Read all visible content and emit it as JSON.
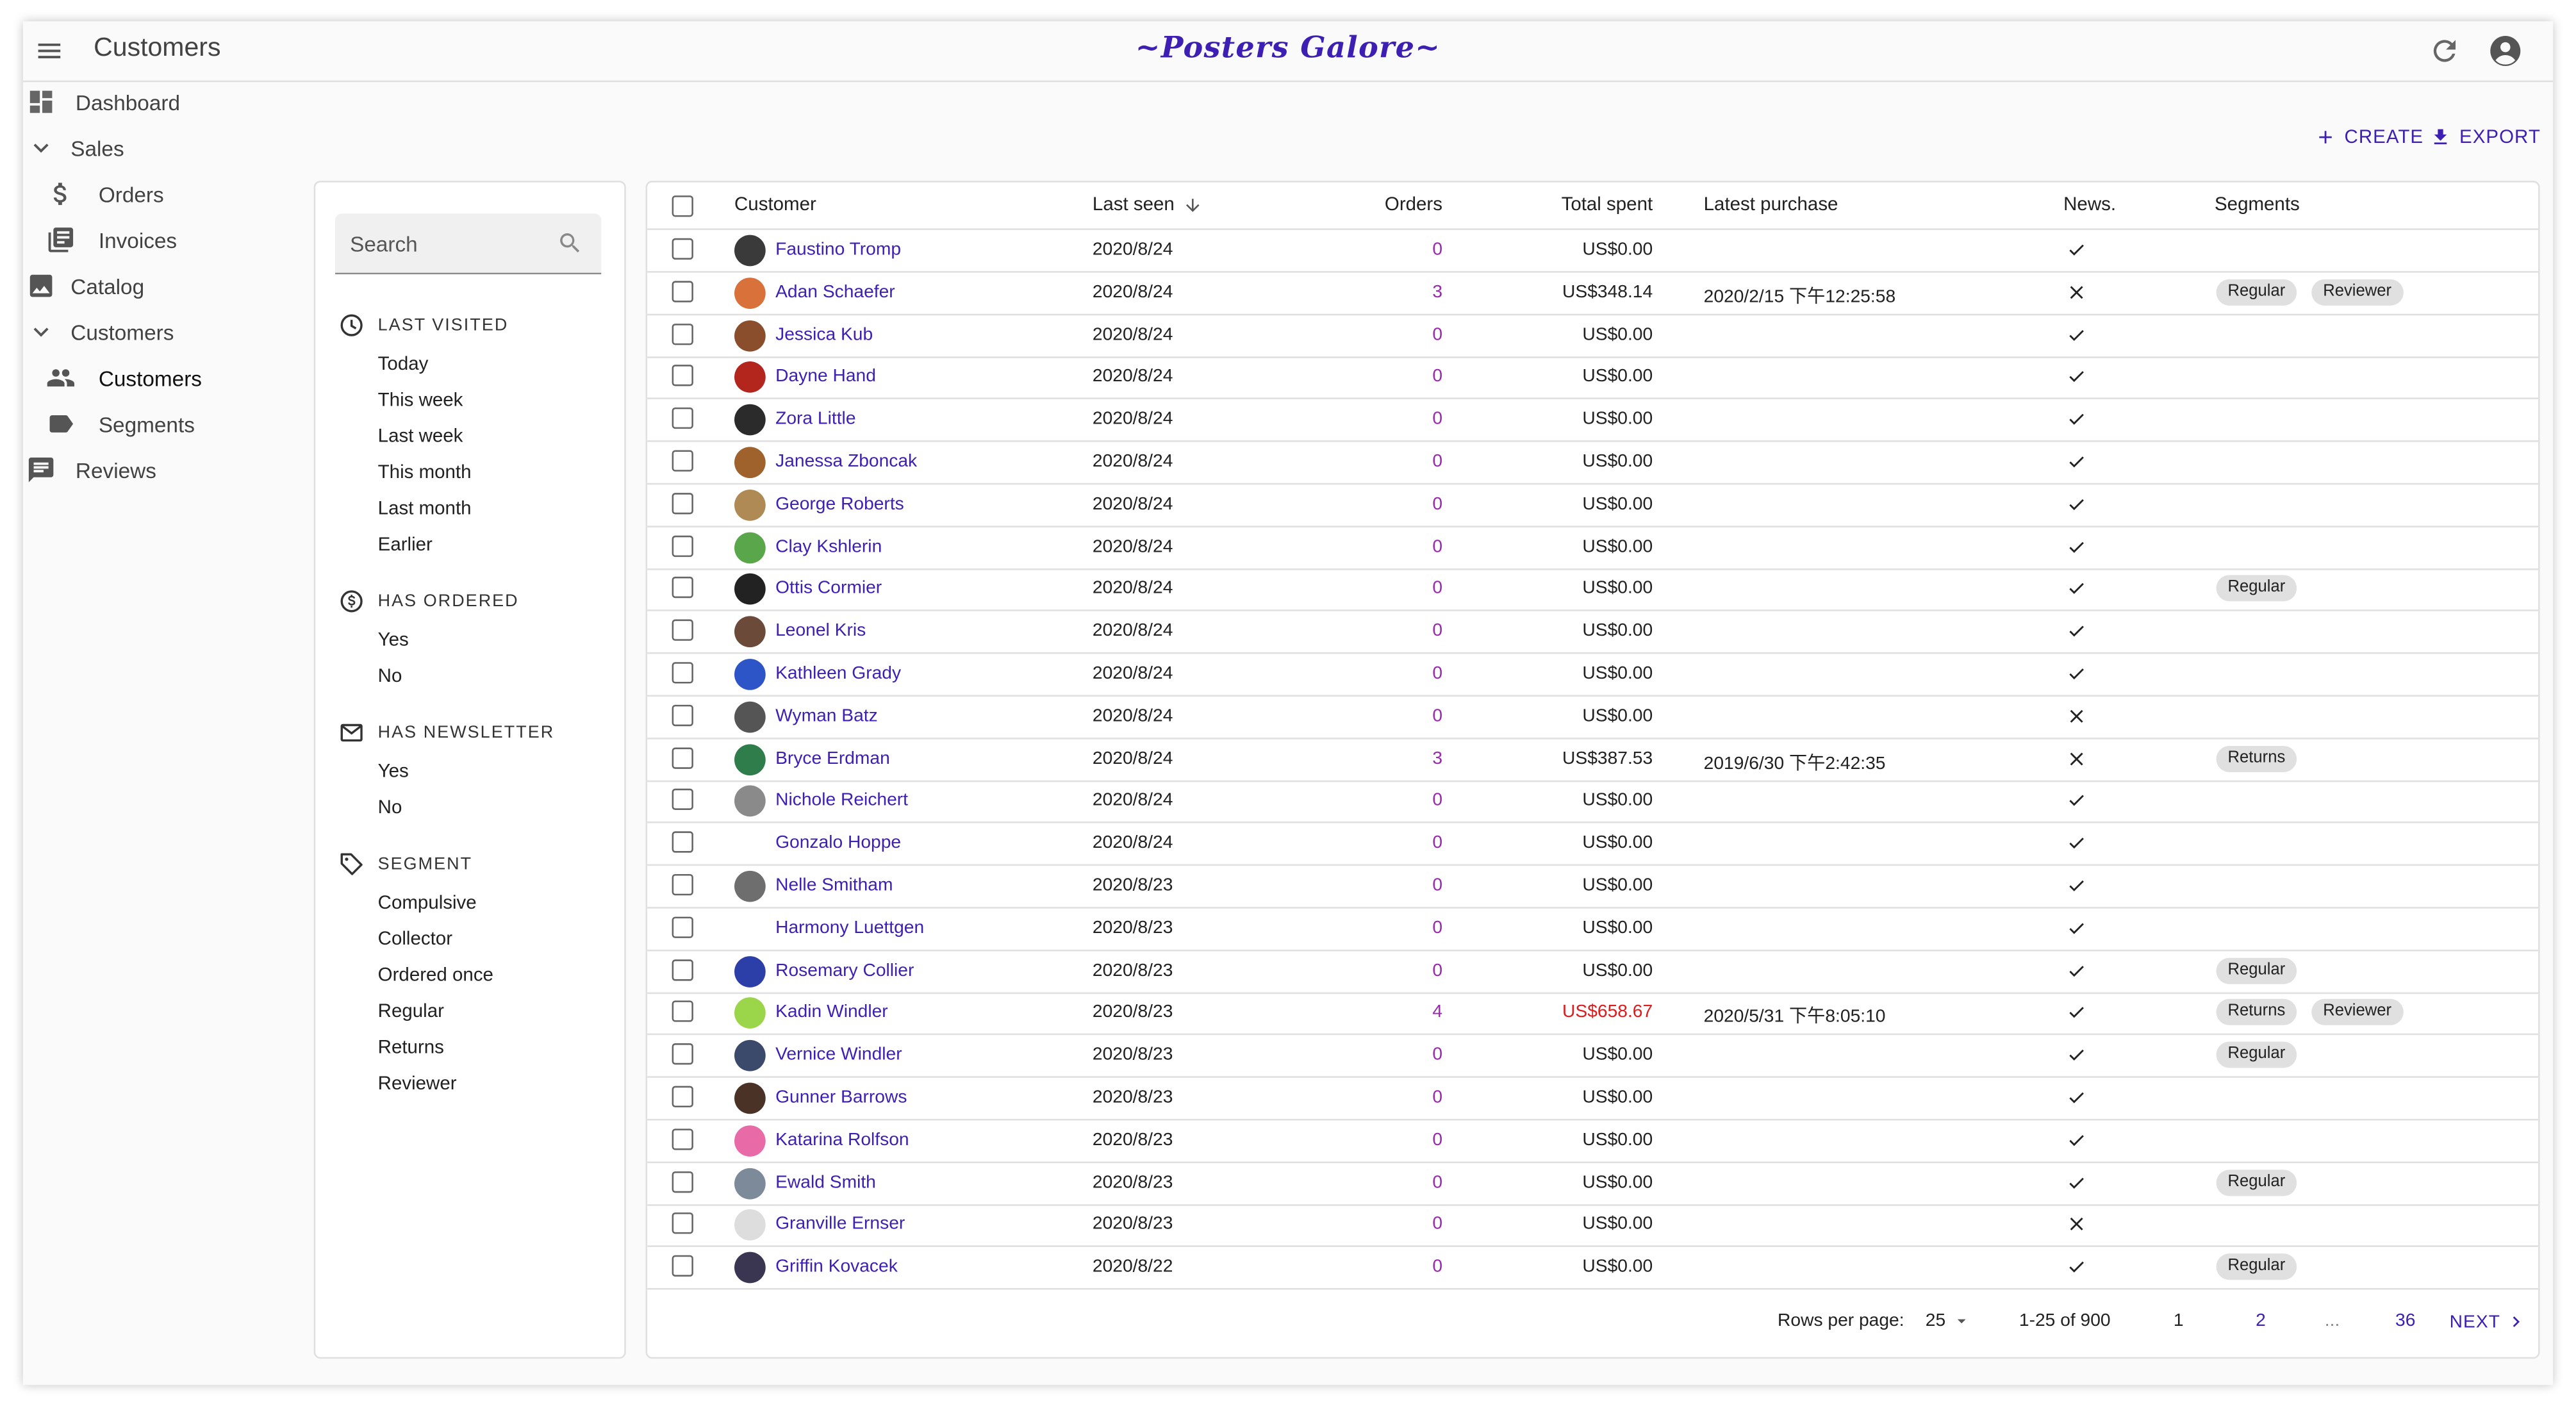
{
  "app": {
    "title": "Customers",
    "brand": "~Posters Galore~"
  },
  "sidebar": {
    "items": [
      {
        "label": "Dashboard",
        "icon": "dashboard-icon",
        "x": 0,
        "y": 0,
        "indent": 0
      },
      {
        "label": "Sales",
        "icon": "chevron-down-icon",
        "indent": 0
      },
      {
        "label": "Orders",
        "icon": "dollar-icon",
        "indent": 1
      },
      {
        "label": "Invoices",
        "icon": "invoice-icon",
        "indent": 1
      },
      {
        "label": "Catalog",
        "icon": "image-icon",
        "indent": 0
      },
      {
        "label": "Customers",
        "icon": "chevron-down-icon",
        "indent": 0
      },
      {
        "label": "Customers",
        "icon": "people-icon",
        "indent": 1,
        "active": true
      },
      {
        "label": "Segments",
        "icon": "label-icon",
        "indent": 1
      },
      {
        "label": "Reviews",
        "icon": "comment-icon",
        "indent": 0
      }
    ]
  },
  "actions": {
    "create": "CREATE",
    "export": "EXPORT"
  },
  "filters": {
    "search_placeholder": "Search",
    "groups": [
      {
        "title": "LAST VISITED",
        "icon": "clock-icon",
        "options": [
          "Today",
          "This week",
          "Last week",
          "This month",
          "Last month",
          "Earlier"
        ]
      },
      {
        "title": "HAS ORDERED",
        "icon": "dollar-circle-icon",
        "options": [
          "Yes",
          "No"
        ]
      },
      {
        "title": "HAS NEWSLETTER",
        "icon": "mail-icon",
        "options": [
          "Yes",
          "No"
        ]
      },
      {
        "title": "SEGMENT",
        "icon": "tag-icon",
        "options": [
          "Compulsive",
          "Collector",
          "Ordered once",
          "Regular",
          "Returns",
          "Reviewer"
        ]
      }
    ]
  },
  "table": {
    "columns": {
      "customer": "Customer",
      "last_seen": "Last seen",
      "orders": "Orders",
      "total_spent": "Total spent",
      "latest_purchase": "Latest purchase",
      "news": "News.",
      "segments": "Segments"
    },
    "rows": [
      {
        "name": "Faustino Tromp",
        "last_seen": "2020/8/24",
        "orders": "0",
        "spent": "US$0.00",
        "purchase": "",
        "news": true,
        "segments": [],
        "avatar": "#3a3a3a"
      },
      {
        "name": "Adan Schaefer",
        "last_seen": "2020/8/24",
        "orders": "3",
        "spent": "US$348.14",
        "purchase": "2020/2/15 下午12:25:58",
        "news": false,
        "segments": [
          "Regular",
          "Reviewer"
        ],
        "avatar": "#d9713a"
      },
      {
        "name": "Jessica Kub",
        "last_seen": "2020/8/24",
        "orders": "0",
        "spent": "US$0.00",
        "purchase": "",
        "news": true,
        "segments": [],
        "avatar": "#8a4e2c"
      },
      {
        "name": "Dayne Hand",
        "last_seen": "2020/8/24",
        "orders": "0",
        "spent": "US$0.00",
        "purchase": "",
        "news": true,
        "segments": [],
        "avatar": "#b3261e"
      },
      {
        "name": "Zora Little",
        "last_seen": "2020/8/24",
        "orders": "0",
        "spent": "US$0.00",
        "purchase": "",
        "news": true,
        "segments": [],
        "avatar": "#2b2b2b"
      },
      {
        "name": "Janessa Zboncak",
        "last_seen": "2020/8/24",
        "orders": "0",
        "spent": "US$0.00",
        "purchase": "",
        "news": true,
        "segments": [],
        "avatar": "#a0622d"
      },
      {
        "name": "George Roberts",
        "last_seen": "2020/8/24",
        "orders": "0",
        "spent": "US$0.00",
        "purchase": "",
        "news": true,
        "segments": [],
        "avatar": "#b08a55"
      },
      {
        "name": "Clay Kshlerin",
        "last_seen": "2020/8/24",
        "orders": "0",
        "spent": "US$0.00",
        "purchase": "",
        "news": true,
        "segments": [],
        "avatar": "#5aa64a"
      },
      {
        "name": "Ottis Cormier",
        "last_seen": "2020/8/24",
        "orders": "0",
        "spent": "US$0.00",
        "purchase": "",
        "news": true,
        "segments": [
          "Regular"
        ],
        "avatar": "#222222"
      },
      {
        "name": "Leonel Kris",
        "last_seen": "2020/8/24",
        "orders": "0",
        "spent": "US$0.00",
        "purchase": "",
        "news": true,
        "segments": [],
        "avatar": "#6b4a3a"
      },
      {
        "name": "Kathleen Grady",
        "last_seen": "2020/8/24",
        "orders": "0",
        "spent": "US$0.00",
        "purchase": "",
        "news": true,
        "segments": [],
        "avatar": "#2d55c7"
      },
      {
        "name": "Wyman Batz",
        "last_seen": "2020/8/24",
        "orders": "0",
        "spent": "US$0.00",
        "purchase": "",
        "news": false,
        "segments": [],
        "avatar": "#555555"
      },
      {
        "name": "Bryce Erdman",
        "last_seen": "2020/8/24",
        "orders": "3",
        "spent": "US$387.53",
        "purchase": "2019/6/30 下午2:42:35",
        "news": false,
        "segments": [
          "Returns"
        ],
        "avatar": "#2f7d4a"
      },
      {
        "name": "Nichole Reichert",
        "last_seen": "2020/8/24",
        "orders": "0",
        "spent": "US$0.00",
        "purchase": "",
        "news": true,
        "segments": [],
        "avatar": "#8a8a8a"
      },
      {
        "name": "Gonzalo Hoppe",
        "last_seen": "2020/8/24",
        "orders": "0",
        "spent": "US$0.00",
        "purchase": "",
        "news": true,
        "segments": [],
        "avatar": ""
      },
      {
        "name": "Nelle Smitham",
        "last_seen": "2020/8/23",
        "orders": "0",
        "spent": "US$0.00",
        "purchase": "",
        "news": true,
        "segments": [],
        "avatar": "#6e6e6e"
      },
      {
        "name": "Harmony Luettgen",
        "last_seen": "2020/8/23",
        "orders": "0",
        "spent": "US$0.00",
        "purchase": "",
        "news": true,
        "segments": [],
        "avatar": ""
      },
      {
        "name": "Rosemary Collier",
        "last_seen": "2020/8/23",
        "orders": "0",
        "spent": "US$0.00",
        "purchase": "",
        "news": true,
        "segments": [
          "Regular"
        ],
        "avatar": "#2c3fa8"
      },
      {
        "name": "Kadin Windler",
        "last_seen": "2020/8/23",
        "orders": "4",
        "spent": "US$658.67",
        "purchase": "2020/5/31 下午8:05:10",
        "news": true,
        "segments": [
          "Returns",
          "Reviewer"
        ],
        "avatar": "#9bd64a",
        "spent_color": "#e01b1b"
      },
      {
        "name": "Vernice Windler",
        "last_seen": "2020/8/23",
        "orders": "0",
        "spent": "US$0.00",
        "purchase": "",
        "news": true,
        "segments": [
          "Regular"
        ],
        "avatar": "#3b4a6b"
      },
      {
        "name": "Gunner Barrows",
        "last_seen": "2020/8/23",
        "orders": "0",
        "spent": "US$0.00",
        "purchase": "",
        "news": true,
        "segments": [],
        "avatar": "#4a3326"
      },
      {
        "name": "Katarina Rolfson",
        "last_seen": "2020/8/23",
        "orders": "0",
        "spent": "US$0.00",
        "purchase": "",
        "news": true,
        "segments": [],
        "avatar": "#e86aa6"
      },
      {
        "name": "Ewald Smith",
        "last_seen": "2020/8/23",
        "orders": "0",
        "spent": "US$0.00",
        "purchase": "",
        "news": true,
        "segments": [
          "Regular"
        ],
        "avatar": "#7d8a99"
      },
      {
        "name": "Granville Ernser",
        "last_seen": "2020/8/23",
        "orders": "0",
        "spent": "US$0.00",
        "purchase": "",
        "news": false,
        "segments": [],
        "avatar": "#dddddd"
      },
      {
        "name": "Griffin Kovacek",
        "last_seen": "2020/8/22",
        "orders": "0",
        "spent": "US$0.00",
        "purchase": "",
        "news": true,
        "segments": [
          "Regular"
        ],
        "avatar": "#3a3550"
      }
    ]
  },
  "pagination": {
    "rows_per_page_label": "Rows per page:",
    "rows_per_page": "25",
    "range": "1-25 of 900",
    "pages": [
      "1",
      "2",
      "...",
      "36"
    ],
    "next": "NEXT"
  },
  "colors": {
    "accent": "#3d1fb4",
    "orders": "#9c27b0",
    "alert": "#e01b1b"
  }
}
